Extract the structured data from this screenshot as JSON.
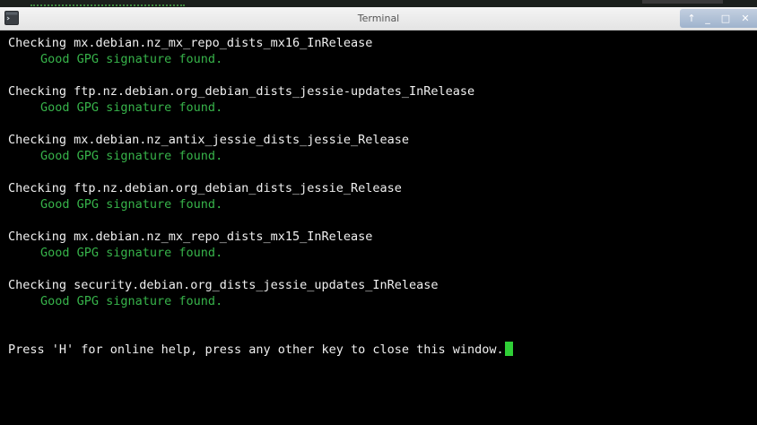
{
  "window": {
    "title": "Terminal",
    "controls": {
      "up": "↑",
      "minimize": "_",
      "maximize": "□",
      "close": "✕"
    }
  },
  "terminal": {
    "checks": [
      {
        "checking": "Checking mx.debian.nz_mx_repo_dists_mx16_InRelease",
        "result": "Good GPG signature found."
      },
      {
        "checking": "Checking ftp.nz.debian.org_debian_dists_jessie-updates_InRelease",
        "result": "Good GPG signature found."
      },
      {
        "checking": "Checking mx.debian.nz_antix_jessie_dists_jessie_Release",
        "result": "Good GPG signature found."
      },
      {
        "checking": "Checking ftp.nz.debian.org_debian_dists_jessie_Release",
        "result": "Good GPG signature found."
      },
      {
        "checking": "Checking mx.debian.nz_mx_repo_dists_mx15_InRelease",
        "result": "Good GPG signature found."
      },
      {
        "checking": "Checking security.debian.org_dists_jessie_updates_InRelease",
        "result": "Good GPG signature found."
      }
    ],
    "prompt": "Press 'H' for online help, press any other key to close this window."
  },
  "colors": {
    "ok": "#37b34a",
    "text": "#f0f0f0",
    "cursor": "#2fcf36",
    "background": "#000000"
  },
  "icons": {
    "app": "terminal-icon"
  }
}
